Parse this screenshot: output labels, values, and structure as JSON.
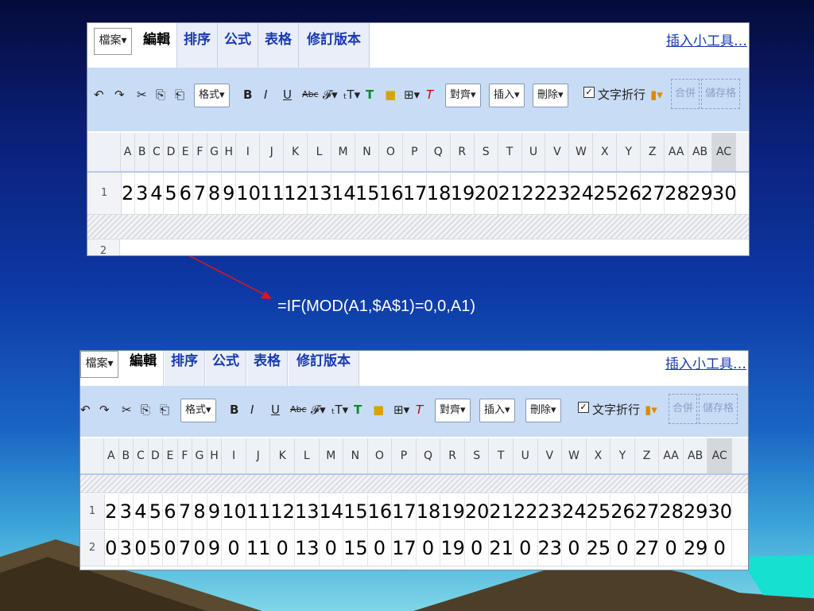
{
  "formula": "=IF(MOD(A1,$A$1)=0,0,A1)",
  "tabs": {
    "file": "檔案▾",
    "edit": "編輯",
    "sort": "排序",
    "formula": "公式",
    "table": "表格",
    "revision": "修訂版本"
  },
  "tools_link": "插入小工具…",
  "toolbar": {
    "undo": "↶",
    "redo": "↷",
    "cut": "✂",
    "copy": "⎘",
    "paste": "⎗",
    "format": "格式▾",
    "bold": "B",
    "italic": "I",
    "underline": "U",
    "strike": "Abc",
    "font": "𝓕▾",
    "size": "ₜT▾",
    "text_color": "T",
    "fill_color": "■",
    "border": "⊞▾",
    "clear_format": "T",
    "align": "對齊▾",
    "insert": "插入▾",
    "delete": "刪除▾",
    "wrap_check": "✓",
    "wrap_label": "文字折行",
    "chart": "▮▾",
    "merge": "合併",
    "save": "儲存格"
  },
  "columns": [
    "A",
    "B",
    "C",
    "D",
    "E",
    "F",
    "G",
    "H",
    "I",
    "J",
    "K",
    "L",
    "M",
    "N",
    "O",
    "P",
    "Q",
    "R",
    "S",
    "T",
    "U",
    "V",
    "W",
    "X",
    "Y",
    "Z",
    "AA",
    "AB",
    "AC"
  ],
  "top_sheet": {
    "rows": [
      {
        "num": "1",
        "cells": [
          "2",
          "3",
          "4",
          "5",
          "6",
          "7",
          "8",
          "9",
          "10",
          "11",
          "12",
          "13",
          "14",
          "15",
          "16",
          "17",
          "18",
          "19",
          "20",
          "21",
          "22",
          "23",
          "24",
          "25",
          "26",
          "27",
          "28",
          "29",
          "30"
        ]
      }
    ],
    "partial_row_num": "2"
  },
  "bottom_sheet": {
    "rows": [
      {
        "num": "1",
        "cells": [
          "2",
          "3",
          "4",
          "5",
          "6",
          "7",
          "8",
          "9",
          "10",
          "11",
          "12",
          "13",
          "14",
          "15",
          "16",
          "17",
          "18",
          "19",
          "20",
          "21",
          "22",
          "23",
          "24",
          "25",
          "26",
          "27",
          "28",
          "29",
          "30"
        ]
      },
      {
        "num": "2",
        "cells": [
          "0",
          "3",
          "0",
          "5",
          "0",
          "7",
          "0",
          "9",
          "0",
          "11",
          "0",
          "13",
          "0",
          "15",
          "0",
          "17",
          "0",
          "19",
          "0",
          "21",
          "0",
          "23",
          "0",
          "25",
          "0",
          "27",
          "0",
          "29",
          "0"
        ]
      }
    ]
  },
  "colors": {
    "arrow": "#e0141e",
    "accent": "#1a3ab0",
    "toolbar_bg": "#c9dcf6"
  }
}
